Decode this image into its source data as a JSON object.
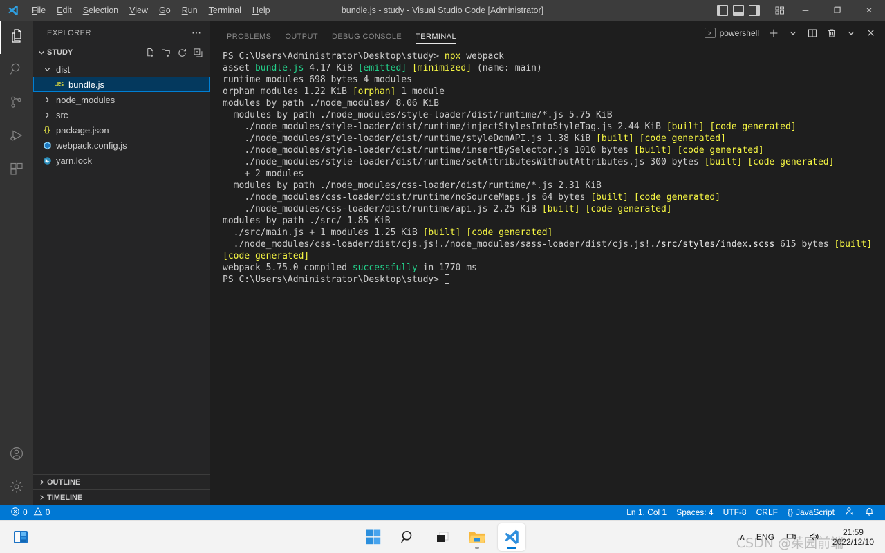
{
  "titlebar": {
    "window_title": "bundle.js - study - Visual Studio Code [Administrator]",
    "menus": [
      {
        "label": "File",
        "mn": "F"
      },
      {
        "label": "Edit",
        "mn": "E"
      },
      {
        "label": "Selection",
        "mn": "S"
      },
      {
        "label": "View",
        "mn": "V"
      },
      {
        "label": "Go",
        "mn": "G"
      },
      {
        "label": "Run",
        "mn": "R"
      },
      {
        "label": "Terminal",
        "mn": "T"
      },
      {
        "label": "Help",
        "mn": "H"
      }
    ],
    "minimize": "─",
    "maximize": "❐",
    "close": "✕"
  },
  "activitybar": {
    "items": [
      {
        "name": "explorer",
        "active": true
      },
      {
        "name": "search",
        "active": false
      },
      {
        "name": "source-control",
        "active": false
      },
      {
        "name": "run-and-debug",
        "active": false
      },
      {
        "name": "extensions",
        "active": false
      }
    ],
    "bottom": [
      {
        "name": "accounts"
      },
      {
        "name": "manage-settings"
      }
    ]
  },
  "sidebar": {
    "title": "EXPLORER",
    "more_actions": "⋯",
    "project": {
      "name": "STUDY",
      "expanded": true,
      "actions": [
        "new-file",
        "new-folder",
        "refresh",
        "collapse-all"
      ]
    },
    "tree": [
      {
        "label": "dist",
        "type": "folder",
        "expanded": true,
        "depth": 1,
        "selected": false
      },
      {
        "label": "bundle.js",
        "type": "file-js",
        "depth": 2,
        "selected": true
      },
      {
        "label": "node_modules",
        "type": "folder",
        "expanded": false,
        "depth": 1,
        "selected": false
      },
      {
        "label": "src",
        "type": "folder",
        "expanded": false,
        "depth": 1,
        "selected": false
      },
      {
        "label": "package.json",
        "type": "file-json",
        "depth": 1,
        "selected": false
      },
      {
        "label": "webpack.config.js",
        "type": "file-webpack",
        "depth": 1,
        "selected": false
      },
      {
        "label": "yarn.lock",
        "type": "file-yarn",
        "depth": 1,
        "selected": false
      }
    ],
    "bottom_panels": [
      {
        "label": "OUTLINE"
      },
      {
        "label": "TIMELINE"
      }
    ]
  },
  "panel": {
    "tabs": [
      {
        "label": "PROBLEMS",
        "active": false
      },
      {
        "label": "OUTPUT",
        "active": false
      },
      {
        "label": "DEBUG CONSOLE",
        "active": false
      },
      {
        "label": "TERMINAL",
        "active": true
      }
    ],
    "terminal_name": "powershell",
    "actions": [
      "new-terminal",
      "terminal-dropdown",
      "split-terminal",
      "kill-terminal",
      "panel-chevron",
      "close-panel"
    ]
  },
  "terminal": {
    "colors": {
      "fg": "#cccccc",
      "green": "#23d18b",
      "yellow": "#f5f543",
      "bright_white": "#e5e5e5"
    },
    "lines": [
      [
        {
          "t": "PS C:\\Users\\Administrator\\Desktop\\study> ",
          "c": "fg"
        },
        {
          "t": "npx",
          "c": "yellow"
        },
        {
          "t": " webpack",
          "c": "fg"
        }
      ],
      [
        {
          "t": "asset ",
          "c": "fg"
        },
        {
          "t": "bundle.js",
          "c": "green"
        },
        {
          "t": " 4.17 KiB ",
          "c": "fg"
        },
        {
          "t": "[emitted]",
          "c": "green"
        },
        {
          "t": " ",
          "c": "fg"
        },
        {
          "t": "[minimized]",
          "c": "yellow"
        },
        {
          "t": " (name: main)",
          "c": "fg"
        }
      ],
      [
        {
          "t": "runtime modules 698 bytes 4 modules",
          "c": "fg"
        }
      ],
      [
        {
          "t": "orphan modules 1.22 KiB ",
          "c": "fg"
        },
        {
          "t": "[orphan]",
          "c": "yellow"
        },
        {
          "t": " 1 module",
          "c": "fg"
        }
      ],
      [
        {
          "t": "modules by path ./node_modules/ 8.06 KiB",
          "c": "fg"
        }
      ],
      [
        {
          "t": "  modules by path ./node_modules/style-loader/dist/runtime/*.js 5.75 KiB",
          "c": "fg"
        }
      ],
      [
        {
          "t": "    ./node_modules/style-loader/dist/runtime/injectStylesIntoStyleTag.js 2.44 KiB ",
          "c": "fg"
        },
        {
          "t": "[built]",
          "c": "yellow"
        },
        {
          "t": " ",
          "c": "fg"
        },
        {
          "t": "[code generated]",
          "c": "yellow"
        }
      ],
      [
        {
          "t": "    ./node_modules/style-loader/dist/runtime/styleDomAPI.js 1.38 KiB ",
          "c": "fg"
        },
        {
          "t": "[built]",
          "c": "yellow"
        },
        {
          "t": " ",
          "c": "fg"
        },
        {
          "t": "[code generated]",
          "c": "yellow"
        }
      ],
      [
        {
          "t": "    ./node_modules/style-loader/dist/runtime/insertBySelector.js 1010 bytes ",
          "c": "fg"
        },
        {
          "t": "[built]",
          "c": "yellow"
        },
        {
          "t": " ",
          "c": "fg"
        },
        {
          "t": "[code generated]",
          "c": "yellow"
        }
      ],
      [
        {
          "t": "    ./node_modules/style-loader/dist/runtime/setAttributesWithoutAttributes.js 300 bytes ",
          "c": "fg"
        },
        {
          "t": "[built]",
          "c": "yellow"
        },
        {
          "t": " ",
          "c": "fg"
        },
        {
          "t": "[code generated]",
          "c": "yellow"
        }
      ],
      [
        {
          "t": "    + 2 modules",
          "c": "fg"
        }
      ],
      [
        {
          "t": "  modules by path ./node_modules/css-loader/dist/runtime/*.js 2.31 KiB",
          "c": "fg"
        }
      ],
      [
        {
          "t": "    ./node_modules/css-loader/dist/runtime/noSourceMaps.js 64 bytes ",
          "c": "fg"
        },
        {
          "t": "[built]",
          "c": "yellow"
        },
        {
          "t": " ",
          "c": "fg"
        },
        {
          "t": "[code generated]",
          "c": "yellow"
        }
      ],
      [
        {
          "t": "    ./node_modules/css-loader/dist/runtime/api.js 2.25 KiB ",
          "c": "fg"
        },
        {
          "t": "[built]",
          "c": "yellow"
        },
        {
          "t": " ",
          "c": "fg"
        },
        {
          "t": "[code generated]",
          "c": "yellow"
        }
      ],
      [
        {
          "t": "modules by path ./src/ 1.85 KiB",
          "c": "fg"
        }
      ],
      [
        {
          "t": "  ./src/main.js + 1 modules 1.25 KiB ",
          "c": "fg"
        },
        {
          "t": "[built]",
          "c": "yellow"
        },
        {
          "t": " ",
          "c": "fg"
        },
        {
          "t": "[code generated]",
          "c": "yellow"
        }
      ],
      [
        {
          "t": "  ./node_modules/css-loader/dist/cjs.js!./node_modules/sass-loader/dist/cjs.js!",
          "c": "fg"
        },
        {
          "t": "./src/styles/index.scss",
          "c": "bright_white"
        },
        {
          "t": " 615 bytes ",
          "c": "fg"
        },
        {
          "t": "[built]",
          "c": "yellow"
        },
        {
          "t": " ",
          "c": "fg"
        },
        {
          "t": "[code generated]",
          "c": "yellow"
        }
      ],
      [
        {
          "t": "webpack 5.75.0 compiled ",
          "c": "fg"
        },
        {
          "t": "successfully",
          "c": "green"
        },
        {
          "t": " in 1770 ms",
          "c": "fg"
        }
      ],
      [
        {
          "t": "PS C:\\Users\\Administrator\\Desktop\\study> ",
          "c": "fg"
        },
        {
          "t": "",
          "c": "cursor"
        }
      ]
    ]
  },
  "statusbar": {
    "errors": "0",
    "warnings": "0",
    "position": "Ln 1, Col 1",
    "spaces": "Spaces: 4",
    "encoding": "UTF-8",
    "eol": "CRLF",
    "language": "JavaScript",
    "feedback_icon": "tweet-feedback-icon",
    "bell_icon": "notifications-bell-icon",
    "background": "#0078d4"
  },
  "taskbar": {
    "start_label": "start-button",
    "items": [
      {
        "name": "start",
        "active": false
      },
      {
        "name": "search",
        "active": false
      },
      {
        "name": "task-view",
        "active": false
      },
      {
        "name": "file-explorer",
        "active": false
      },
      {
        "name": "visual-studio-code",
        "active": true
      }
    ],
    "tray": {
      "chevron": "∧",
      "language": "ENG",
      "network_icon": "network-icon",
      "volume_icon": "volume-icon",
      "time": "21:59",
      "date": "2022/12/10"
    },
    "watermark": "CSDN @茱园前端"
  }
}
